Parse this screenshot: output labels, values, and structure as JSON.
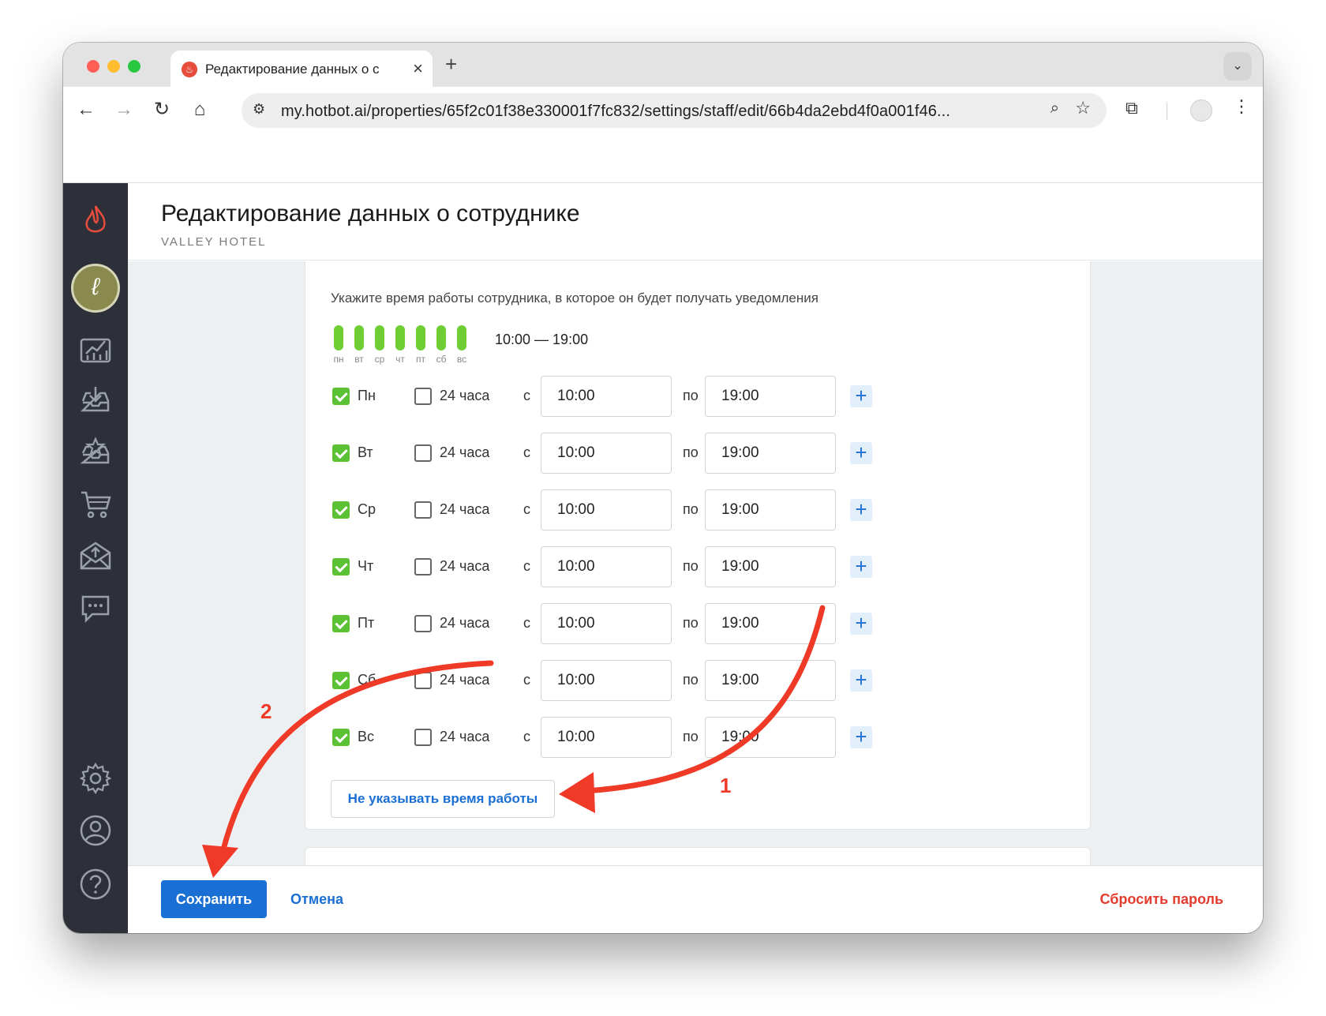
{
  "browser": {
    "tab_title": "Редактирование данных о с",
    "url": "my.hotbot.ai/properties/65f2c01f38e330001f7fc832/settings/staff/edit/66b4da2ebd4f0a001f46..."
  },
  "header": {
    "title": "Редактирование данных о сотруднике",
    "subtitle": "VALLEY HOTEL"
  },
  "schedule": {
    "hint": "Укажите время работы сотрудника, в которое он будет получать уведомления",
    "week_labels": [
      "пн",
      "вт",
      "ср",
      "чт",
      "пт",
      "сб",
      "вс"
    ],
    "summary": "10:00 — 19:00",
    "full_day_label": "24 часа",
    "from_label": "с",
    "to_label": "по",
    "days": [
      {
        "label": "Пн",
        "enabled": true,
        "full_day": false,
        "from": "10:00",
        "to": "19:00"
      },
      {
        "label": "Вт",
        "enabled": true,
        "full_day": false,
        "from": "10:00",
        "to": "19:00"
      },
      {
        "label": "Ср",
        "enabled": true,
        "full_day": false,
        "from": "10:00",
        "to": "19:00"
      },
      {
        "label": "Чт",
        "enabled": true,
        "full_day": false,
        "from": "10:00",
        "to": "19:00"
      },
      {
        "label": "Пт",
        "enabled": true,
        "full_day": false,
        "from": "10:00",
        "to": "19:00"
      },
      {
        "label": "Сб",
        "enabled": true,
        "full_day": false,
        "from": "10:00",
        "to": "19:00"
      },
      {
        "label": "Вс",
        "enabled": true,
        "full_day": false,
        "from": "10:00",
        "to": "19:00"
      }
    ],
    "no_time_button": "Не указывать время работы"
  },
  "footer": {
    "save": "Сохранить",
    "cancel": "Отмена",
    "reset_password": "Сбросить пароль"
  },
  "annotations": {
    "step1": "1",
    "step2": "2",
    "arrow_color": "#f03a28"
  },
  "colors": {
    "accent": "#1a6fd4",
    "active_day": "#6fce33",
    "danger": "#e33b2e",
    "sidebar": "#2d3038"
  }
}
